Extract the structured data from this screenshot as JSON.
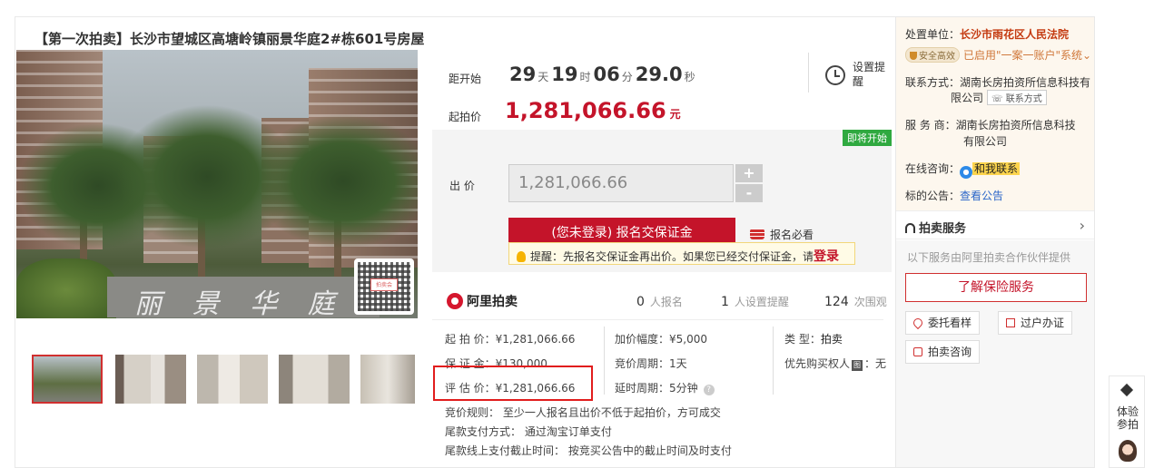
{
  "title": "【第一次拍卖】长沙市望城区高塘岭镇丽景华庭2#栋601号房屋",
  "gallery": {
    "main_sign_text": "丽 景 华 庭",
    "qr_logo": "拍卖会",
    "thumbnails": [
      "thumb-1",
      "thumb-2",
      "thumb-3",
      "thumb-4",
      "thumb-5"
    ]
  },
  "countdown": {
    "label": "距开始",
    "days": "29",
    "days_unit": "天",
    "hours": "19",
    "hours_unit": "时",
    "minutes": "06",
    "minutes_unit": "分",
    "seconds": "29.0",
    "seconds_unit": "秒"
  },
  "set_reminder": {
    "label": "设置提醒",
    "icon": "alarm-clock-icon"
  },
  "start_price": {
    "label": "起拍价",
    "value": "1,281,066.66",
    "unit": "元"
  },
  "bid": {
    "status_badge": "即将开始",
    "label": "出  价",
    "input_value": "1,281,066.66",
    "plus": "+",
    "minus": "-",
    "register_button": "(您未登录) 报名交保证金",
    "must_read": "报名必看",
    "tip_text": "提醒：先报名交保证金再出价。如果您已经交付保证金，请",
    "tip_login": "登录"
  },
  "stats": {
    "brand": "阿里拍卖",
    "signup_count": "0",
    "signup_label": "人报名",
    "remind_count": "1",
    "remind_label": "人设置提醒",
    "view_count": "124",
    "view_label": "次围观"
  },
  "info": {
    "start_price": "起 拍 价：¥1,281,066.66",
    "deposit": "保 证 金：¥130,000",
    "appraisal": "评 估 价：¥1,281,066.66",
    "increment": "加价幅度：¥5,000",
    "period": "竞价周期：1天",
    "delay": "延时周期：5分钟",
    "type_label": "类      型：",
    "type_value": "拍卖",
    "priority_label": "优先购买权人",
    "priority_icon": "图",
    "priority_value": "：无",
    "rule": "竞价规则：  至少一人报名且出价不低于起拍价，方可成交",
    "payment": "尾款支付方式：  通过淘宝订单支付",
    "deadline": "尾款线上支付截止时间：  按竞买公告中的截止时间及时支付"
  },
  "side": {
    "court_label": "处置单位：",
    "court_value": "长沙市雨花区人民法院",
    "safe_badge": "安全高效",
    "one_account": "已启用\"一案一账户\"系统",
    "contact_label": "联系方式：",
    "contact_value_1": "湖南长房拍资所信息科技有",
    "contact_value_2": "限公司",
    "contact_button": "联系方式",
    "service_label": "服  务  商：",
    "service_value_1": "湖南长房拍资所信息科技",
    "service_value_2": "有限公司",
    "consult_label": "在线咨询：",
    "consult_link": "和我联系",
    "notice_label": "标的公告：",
    "notice_link": "查看公告",
    "services_title": "拍卖服务",
    "services_desc": "以下服务由阿里拍卖合作伙伴提供",
    "insurance_button": "了解保险服务",
    "entrust_button": "委托看样",
    "transfer_button": "过户办证",
    "consult_button": "拍卖咨询"
  },
  "float_bar": {
    "label": "体验参拍"
  },
  "colors": {
    "accent": "#c4142a",
    "badge_green": "#2fa940",
    "link": "#2a66c9",
    "highlight_box": "#e11d1d"
  }
}
